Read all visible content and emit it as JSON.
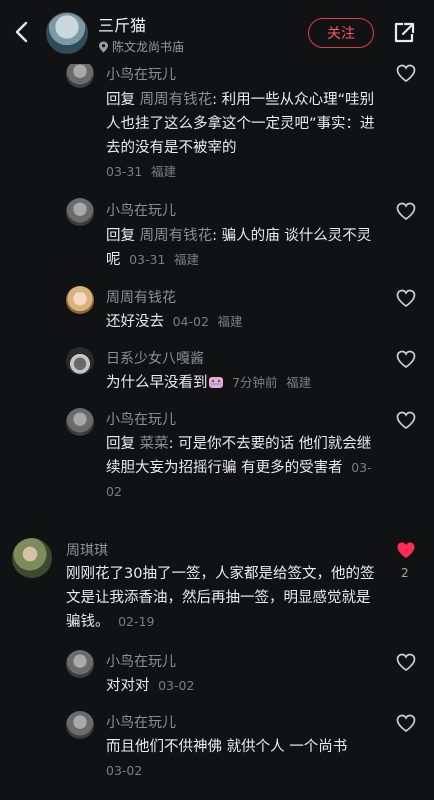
{
  "header": {
    "title": "三斤猫",
    "location": "陈文龙尚书庙",
    "follow_label": "关注"
  },
  "comments": [
    {
      "name": "小鸟在玩儿",
      "reply_word": "回复",
      "reply_to": "周周有钱花",
      "body": ": 利用一些从众心理“哇别人也挂了这么多拿这个一定灵吧”事实：进去的没有是不被宰的",
      "date": "03-31",
      "region": "福建"
    },
    {
      "name": "小鸟在玩儿",
      "reply_word": "回复",
      "reply_to": "周周有钱花",
      "body": ": 骗人的庙 谈什么灵不灵呢",
      "date": "03-31",
      "region": "福建"
    },
    {
      "name": "周周有钱花",
      "body": "还好没去",
      "date": "04-02",
      "region": "福建"
    },
    {
      "name": "日系少女八嘎酱",
      "body": "为什么早没看到",
      "date": "7分钟前",
      "region": "福建"
    },
    {
      "name": "小鸟在玩儿",
      "reply_word": "回复",
      "reply_to": "菜菜",
      "body": ": 可是你不去要的话 他们就会继续胆大妄为招摇行骗 有更多的受害者",
      "date": "03-02"
    },
    {
      "name": "周琪琪",
      "body": "刚刚花了30抽了一签，人家都是给签文，他的签文是让我添香油，然后再抽一签，明显感觉就是骗钱。",
      "date": "02-19",
      "likes": "2"
    },
    {
      "name": "小鸟在玩儿",
      "body": "对对对",
      "date": "03-02"
    },
    {
      "name": "小鸟在玩儿",
      "body": "而且他们不供神佛 就供个人 一个尚书",
      "date": "03-02"
    }
  ],
  "colors": {
    "background": "#111214",
    "accent": "#e23a48",
    "liked": "#ff2d55"
  },
  "icons": [
    "back-icon",
    "location-icon",
    "share-icon",
    "heart-icon"
  ]
}
